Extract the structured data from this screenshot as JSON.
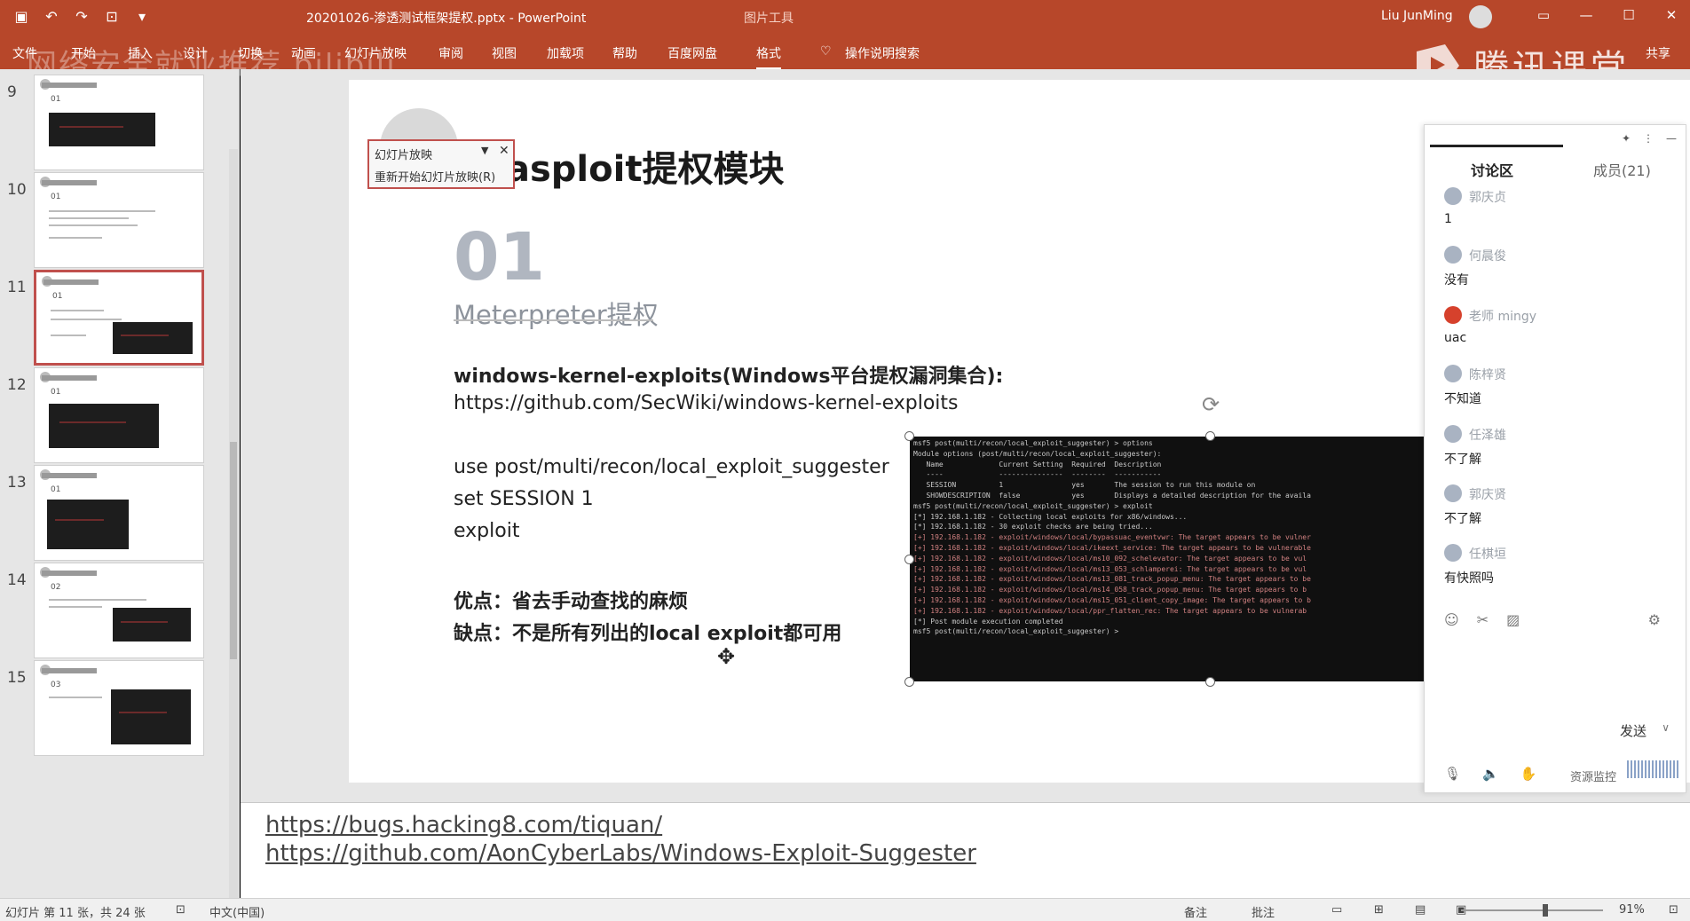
{
  "window": {
    "doc_title": "20201026-渗透测试框架提权.pptx - PowerPoint",
    "context_label": "图片工具",
    "user": "Liu JunMing",
    "win_buttons": [
      "▭",
      "—",
      "☐",
      "✕"
    ]
  },
  "ribbon": {
    "tabs": [
      "文件",
      "开始",
      "插入",
      "设计",
      "切换",
      "动画",
      "幻灯片放映",
      "审阅",
      "视图",
      "加载项",
      "帮助",
      "百度网盘",
      "格式"
    ],
    "search": "操作说明搜索",
    "share": "共享"
  },
  "watermarks": {
    "left": "网络安全就业推荐 bilibili",
    "right": "腾讯课堂"
  },
  "thumbnails": [
    {
      "num": "9",
      "tag": "01"
    },
    {
      "num": "10",
      "tag": "01"
    },
    {
      "num": "11",
      "tag": "01"
    },
    {
      "num": "12",
      "tag": "01"
    },
    {
      "num": "13",
      "tag": "01"
    },
    {
      "num": "14",
      "tag": "02"
    },
    {
      "num": "15",
      "tag": "03"
    }
  ],
  "popup": {
    "title": "幻灯片放映",
    "restart": "重新开始幻灯片放映(R)"
  },
  "slide": {
    "title": "asploit提权模块",
    "number": "01",
    "subtitle": "Meterpreter提权",
    "line1": "windows-kernel-exploits(Windows平台提权漏洞集合):",
    "line2": "https://github.com/SecWiki/windows-kernel-exploits",
    "line3": "use post/multi/recon/local_exploit_suggester",
    "line4": "set SESSION 1",
    "line5": "exploit",
    "pro": "优点：省去手动查找的麻烦",
    "con": "缺点：不是所有列出的local exploit都可用"
  },
  "terminal": {
    "lines": [
      "msf5 post(multi/recon/local_exploit_suggester) > options",
      "Module options (post/multi/recon/local_exploit_suggester):",
      "",
      "   Name             Current Setting  Required  Description",
      "   ----             ---------------  --------  -----------",
      "   SESSION          1                yes       The session to run this module on",
      "   SHOWDESCRIPTION  false            yes       Displays a detailed description for the availa",
      "msf5 post(multi/recon/local_exploit_suggester) > exploit",
      "",
      "[*] 192.168.1.182 - Collecting local exploits for x86/windows...",
      "[*] 192.168.1.182 - 30 exploit checks are being tried...",
      "[+] 192.168.1.182 - exploit/windows/local/bypassuac_eventvwr: The target appears to be vulner",
      "[+] 192.168.1.182 - exploit/windows/local/ikeext_service: The target appears to be vulnerable",
      "[+] 192.168.1.182 - exploit/windows/local/ms10_092_schelevator: The target appears to be vul",
      "[+] 192.168.1.182 - exploit/windows/local/ms13_053_schlamperei: The target appears to be vul",
      "[+] 192.168.1.182 - exploit/windows/local/ms13_081_track_popup_menu: The target appears to be",
      "[+] 192.168.1.182 - exploit/windows/local/ms14_058_track_popup_menu: The target appears to b",
      "[+] 192.168.1.182 - exploit/windows/local/ms15_051_client_copy_image: The target appears to b",
      "[+] 192.168.1.182 - exploit/windows/local/ppr_flatten_rec: The target appears to be vulnerab",
      "[*] Post module execution completed",
      "msf5 post(multi/recon/local_exploit_suggester) > "
    ]
  },
  "notes": {
    "link1": "https://bugs.hacking8.com/tiquan/",
    "link2": "https://github.com/AonCyberLabs/Windows-Exploit-Suggester"
  },
  "chat": {
    "tab_discussion": "讨论区",
    "tab_members": "成员(21)",
    "messages": [
      {
        "name": "郭庆贞",
        "text": "1"
      },
      {
        "name": "何晨俊",
        "text": "没有"
      },
      {
        "name": "老师 mingy",
        "text": "uac"
      },
      {
        "name": "陈梓贤",
        "text": "不知道"
      },
      {
        "name": "任泽雄",
        "text": "不了解"
      },
      {
        "name": "郭庆贤",
        "text": "不了解"
      },
      {
        "name": "任棋垣",
        "text": "有快照吗"
      }
    ],
    "send": "发送",
    "monitor": "资源监控"
  },
  "status": {
    "slide_info": "幻灯片 第 11 张，共 24 张",
    "language": "中文(中国)",
    "notes": "备注",
    "comments": "批注",
    "zoom": "91%"
  }
}
